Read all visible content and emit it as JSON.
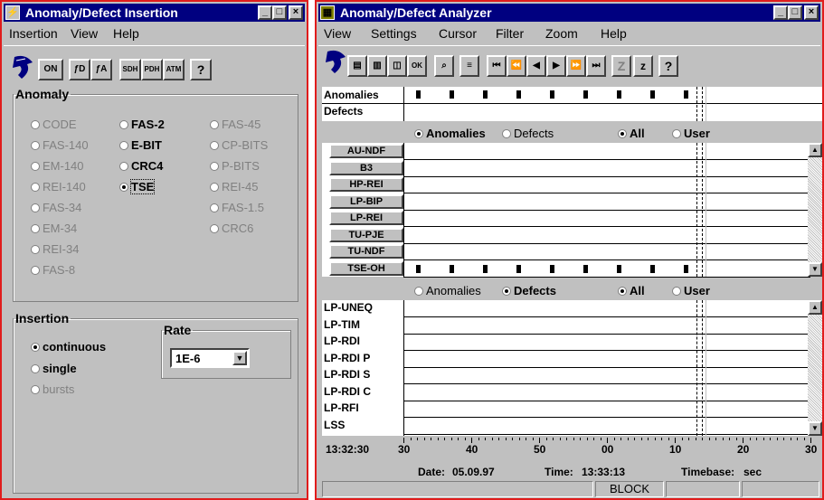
{
  "insertion_window": {
    "title": "Anomaly/Defect Insertion",
    "title_icon": "lightning-icon",
    "menu": [
      "Insertion",
      "View",
      "Help"
    ],
    "toolbar": {
      "on": "ON",
      "d_icon": "ƒD",
      "a_icon": "ƒA",
      "sdh": "SDH",
      "pdh": "PDH",
      "atm": "ATM",
      "help": "?"
    },
    "anomaly_group": {
      "title": "Anomaly",
      "options": [
        {
          "label": "CODE",
          "enabled": false,
          "selected": false
        },
        {
          "label": "FAS-2",
          "enabled": true,
          "selected": false
        },
        {
          "label": "FAS-45",
          "enabled": false,
          "selected": false
        },
        {
          "label": "FAS-140",
          "enabled": false,
          "selected": false
        },
        {
          "label": "E-BIT",
          "enabled": true,
          "selected": false
        },
        {
          "label": "CP-BITS",
          "enabled": false,
          "selected": false
        },
        {
          "label": "EM-140",
          "enabled": false,
          "selected": false
        },
        {
          "label": "CRC4",
          "enabled": true,
          "selected": false
        },
        {
          "label": "P-BITS",
          "enabled": false,
          "selected": false
        },
        {
          "label": "REI-140",
          "enabled": false,
          "selected": false
        },
        {
          "label": "TSE",
          "enabled": true,
          "selected": true
        },
        {
          "label": "REI-45",
          "enabled": false,
          "selected": false
        },
        {
          "label": "FAS-34",
          "enabled": false,
          "selected": false
        },
        {
          "label": "FAS-1.5",
          "enabled": false,
          "selected": false
        },
        {
          "label": "EM-34",
          "enabled": false,
          "selected": false
        },
        {
          "label": "CRC6",
          "enabled": false,
          "selected": false
        },
        {
          "label": "REI-34",
          "enabled": false,
          "selected": false
        },
        {
          "label": "FAS-8",
          "enabled": false,
          "selected": false
        }
      ]
    },
    "insertion_group": {
      "title": "Insertion",
      "continuous": "continuous",
      "single": "single",
      "bursts": "bursts",
      "rate_title": "Rate",
      "rate_value": "1E-6"
    }
  },
  "analyzer_window": {
    "title": "Anomaly/Defect Analyzer",
    "menu": [
      "View",
      "Settings",
      "Cursor",
      "Filter",
      "Zoom",
      "Help"
    ],
    "toolbar": {
      "z1": "Z",
      "z2": "z",
      "help": "?",
      "ok": "OK"
    },
    "top_rows": [
      "Anomalies",
      "Defects"
    ],
    "filter1": {
      "anomalies": "Anomalies",
      "defects": "Defects",
      "all": "All",
      "user": "User",
      "selected_type": "Anomalies",
      "selected_scope": "All"
    },
    "anomaly_rows": [
      "AU-NDF",
      "B3",
      "HP-REI",
      "LP-BIP",
      "LP-REI",
      "TU-PJE",
      "TU-NDF",
      "TSE-OH"
    ],
    "filter2": {
      "anomalies": "Anomalies",
      "defects": "Defects",
      "all": "All",
      "user": "User",
      "selected_type": "Defects",
      "selected_scope": "All"
    },
    "defect_rows": [
      "LP-UNEQ",
      "LP-TIM",
      "LP-RDI",
      "LP-RDI P",
      "LP-RDI S",
      "LP-RDI C",
      "LP-RFI",
      "LSS"
    ],
    "axis": {
      "start_time": "13:32:30",
      "ticks": [
        "30",
        "40",
        "50",
        "00",
        "10",
        "20",
        "30"
      ]
    },
    "footer": {
      "date_label": "Date:",
      "date": "05.09.97",
      "time_label": "Time:",
      "time": "13:33:13",
      "timebase_label": "Timebase:",
      "timebase": "sec"
    },
    "status": {
      "block": "BLOCK"
    }
  }
}
